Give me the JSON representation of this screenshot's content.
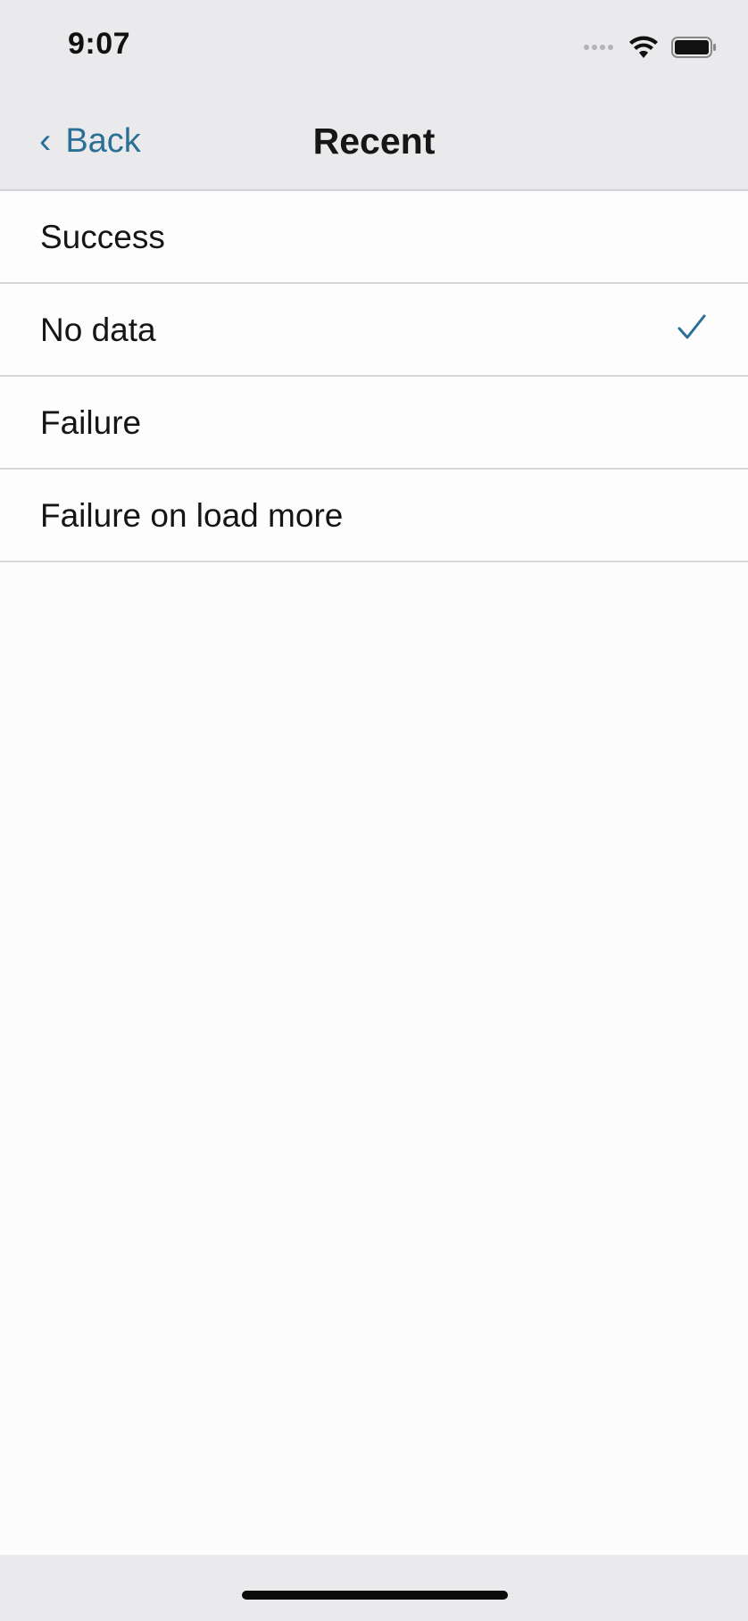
{
  "status_bar": {
    "time": "9:07",
    "icons": [
      "cellular-signal-icon",
      "wifi-icon",
      "battery-icon"
    ]
  },
  "nav_bar": {
    "back_label": "Back",
    "back_icon": "chevron-left-icon",
    "title": "Recent"
  },
  "list": {
    "items": [
      {
        "label": "Success",
        "selected": false
      },
      {
        "label": "No data",
        "selected": true
      },
      {
        "label": "Failure",
        "selected": false
      },
      {
        "label": "Failure on load more",
        "selected": false
      }
    ]
  },
  "colors": {
    "accent": "#2a6f95",
    "bar_background": "#eaeaed",
    "content_background": "#fcfcfc",
    "separator": "#d7d7db"
  }
}
